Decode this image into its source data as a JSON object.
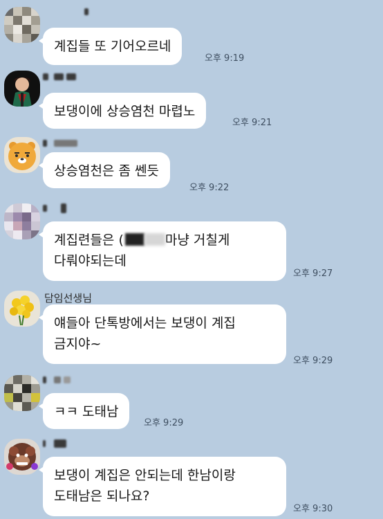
{
  "messages": [
    {
      "sender_visible": "",
      "text_lines": [
        "계집들 또 기어오르네"
      ],
      "time": "오후 9:19",
      "avatar": "pixelated-avatar-icon"
    },
    {
      "sender_visible": "",
      "text_lines": [
        "보댕이에 상승염천 마렵노"
      ],
      "time": "오후 9:21",
      "avatar": "anime-character-avatar-icon"
    },
    {
      "sender_visible": "",
      "text_lines": [
        "상승염천은 좀 쎈듯"
      ],
      "time": "오후 9:22",
      "avatar": "ryan-bear-avatar-icon"
    },
    {
      "sender_visible": "",
      "text_line1_part1": "계집련들은 (",
      "text_line1_part2": "마냥  거칠게",
      "text_line2": "다뤄야되는데",
      "time": "오후 9:27",
      "avatar": "pixelated-avatar-icon"
    },
    {
      "sender_visible": "담임선생님",
      "text_lines": [
        "얘들아 단톡방에서는 보댕이 계집",
        "금지야~"
      ],
      "time": "오후 9:29",
      "avatar": "yellow-flower-avatar-icon"
    },
    {
      "sender_visible": "",
      "text_lines": [
        "ㅋㅋ 도태남"
      ],
      "time": "오후 9:29",
      "avatar": "pixelated-avatar-icon"
    },
    {
      "sender_visible": "",
      "text_lines": [
        "보댕이 계집은 안되는데 한남이랑",
        "도태남은 되나요?"
      ],
      "time": "오후 9:30",
      "avatar": "ape-character-avatar-icon"
    }
  ],
  "colors": {
    "background": "#b8cce0",
    "bubble": "#ffffff",
    "time_text": "#3e4e60"
  }
}
